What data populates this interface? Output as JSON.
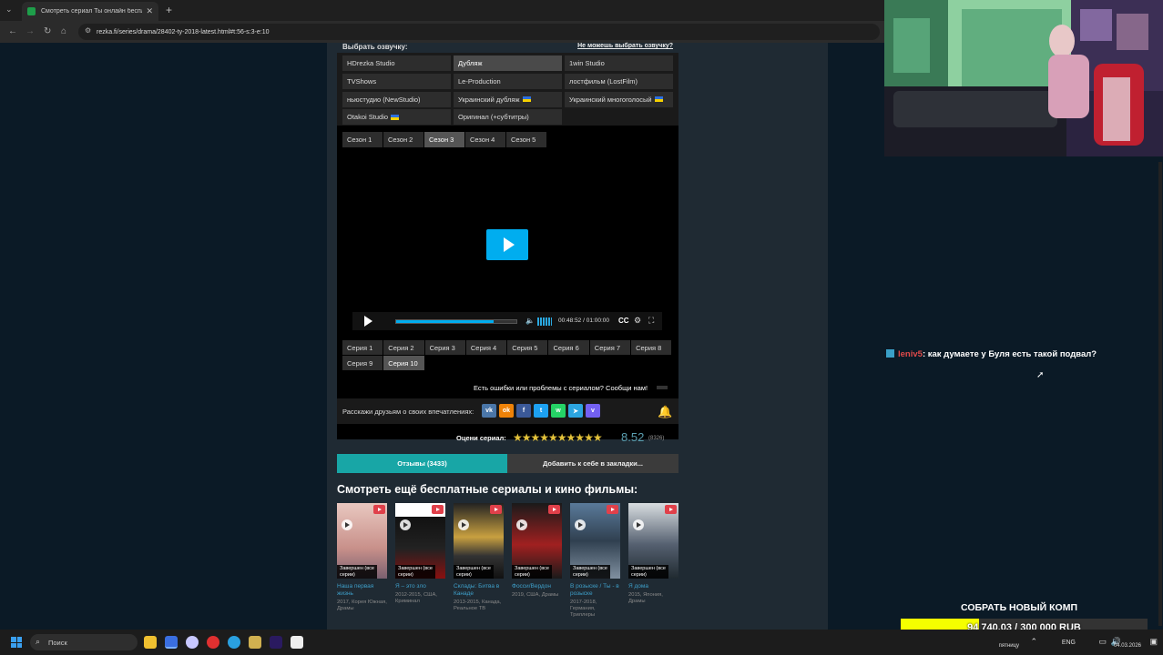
{
  "browser": {
    "tab_title": "Смотреть сериал Ты онлайн бесплатно",
    "url": "rezka.fi/series/drama/28402-ty-2018-latest.html#t:56-s:3-e:10"
  },
  "voice": {
    "heading": "Выбрать озвучку:",
    "help_link": "Не можешь выбрать озвучку?",
    "items": [
      {
        "label": "HDrezka Studio",
        "active": false,
        "flag": false
      },
      {
        "label": "Дубляж",
        "active": true,
        "flag": false
      },
      {
        "label": "1win Studio",
        "active": false,
        "flag": false
      },
      {
        "label": "TVShows",
        "active": false,
        "flag": false
      },
      {
        "label": "Le-Production",
        "active": false,
        "flag": false
      },
      {
        "label": "лостфильм (LostFilm)",
        "active": false,
        "flag": false
      },
      {
        "label": "ньюстудио (NewStudio)",
        "active": false,
        "flag": false
      },
      {
        "label": "Украинский дубляж",
        "active": false,
        "flag": true
      },
      {
        "label": "Украинский многоголосый",
        "active": false,
        "flag": true
      },
      {
        "label": "Otakoi Studio",
        "active": false,
        "flag": true
      },
      {
        "label": "Оригинал (+субтитры)",
        "active": false,
        "flag": false
      }
    ]
  },
  "seasons": [
    {
      "label": "Сезон 1",
      "active": false
    },
    {
      "label": "Сезон 2",
      "active": false
    },
    {
      "label": "Сезон 3",
      "active": true
    },
    {
      "label": "Сезон 4",
      "active": false
    },
    {
      "label": "Сезон 5",
      "active": false
    }
  ],
  "player": {
    "time": "00:48:52 / 01:00:00",
    "cc_label": "CC",
    "progress_fraction": 0.81
  },
  "episodes": [
    {
      "label": "Серия 1",
      "active": false
    },
    {
      "label": "Серия 2",
      "active": false
    },
    {
      "label": "Серия 3",
      "active": false
    },
    {
      "label": "Серия 4",
      "active": false
    },
    {
      "label": "Серия 5",
      "active": false
    },
    {
      "label": "Серия 6",
      "active": false
    },
    {
      "label": "Серия 7",
      "active": false
    },
    {
      "label": "Серия 8",
      "active": false
    },
    {
      "label": "Серия 9",
      "active": false
    },
    {
      "label": "Серия 10",
      "active": true
    }
  ],
  "report_text": "Есть ошибки или проблемы с сериалом? Сообщи нам!",
  "share": {
    "label": "Расскажи друзьям о своих впечатлениях:",
    "icons": [
      {
        "name": "vk-icon",
        "glyph": "vk",
        "color": "#4a76a8"
      },
      {
        "name": "ok-icon",
        "glyph": "ok",
        "color": "#ee8208"
      },
      {
        "name": "facebook-icon",
        "glyph": "f",
        "color": "#3b5998"
      },
      {
        "name": "twitter-icon",
        "glyph": "t",
        "color": "#1da1f2"
      },
      {
        "name": "whatsapp-icon",
        "glyph": "w",
        "color": "#25d366"
      },
      {
        "name": "telegram-icon",
        "glyph": "➤",
        "color": "#2ca5e0"
      },
      {
        "name": "viber-icon",
        "glyph": "v",
        "color": "#7360f2"
      }
    ]
  },
  "rating": {
    "label": "Оцени сериал:",
    "stars": "★★★★★★★★★★",
    "value": "8.52",
    "count": "(8326)"
  },
  "actions": {
    "reviews": "Отзывы (3433)",
    "bookmark": "Добавить к себе в закладки..."
  },
  "more_title": "Смотреть ещё бесплатные сериалы и кино фильмы:",
  "recommendations": [
    {
      "title": "Наша первая жизнь",
      "info": "2017, Корея Южная, Драмы",
      "status": "Завершен (все серии)",
      "bg": "linear-gradient(#e9c8c0,#c8908a 60%,#7a6070)"
    },
    {
      "title": "Я – это зло",
      "info": "2012-2015, США, Криминал",
      "status": "Завершен (все серии)",
      "bg": "linear-gradient(#fff 0 18%,#111 18%,#222 60%,#8a1010)"
    },
    {
      "title": "Склады: Битва в Канаде",
      "info": "2013-2015, Канада, Реальное ТВ",
      "status": "Завершен (все серии)",
      "bg": "linear-gradient(#222,#c8a040 45%,#333 70%,#111)"
    },
    {
      "title": "Фосси/Вердон",
      "info": "2019, США, Драмы",
      "status": "Завершен (все серии)",
      "bg": "linear-gradient(#1a1a1a,#a02020 55%,#1a1a1a)"
    },
    {
      "title": "В розыске / Ты - в розыске",
      "info": "2017-2018, Германия, Триллеры",
      "status": "Завершен (все серии)",
      "bg": "linear-gradient(#5a7a9a,#304050 50%,#8090a0)"
    },
    {
      "title": "Я дома",
      "info": "2015, Япония, Драмы",
      "status": "Завершен (все серии)",
      "bg": "linear-gradient(#d8dde0,#556070 55%,#202a30)"
    }
  ],
  "chat": {
    "user": "leniv5",
    "message": ": как думаете у Буля есть такой подвал?"
  },
  "donation": {
    "title": "СОБРАТЬ НОВЫЙ КОМП",
    "amount": "94 740.03 / 300 000 RUB",
    "fraction": 0.316
  },
  "taskbar": {
    "search_placeholder": "Поиск",
    "lang": "ENG",
    "weekday": "пятницу",
    "date": "04.03.2026"
  }
}
